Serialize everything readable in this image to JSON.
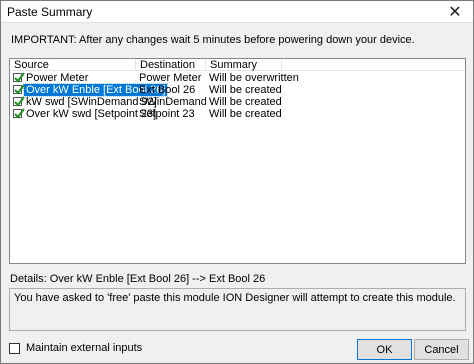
{
  "window": {
    "title": "Paste Summary",
    "close_glyph": "✕"
  },
  "important_text": "IMPORTANT: After any changes wait 5 minutes before powering down your device.",
  "table": {
    "columns": [
      "Source",
      "Destination",
      "Summary"
    ],
    "rows": [
      {
        "source": "Power Meter",
        "destination": "Power Meter",
        "summary": "Will be overwritten",
        "checked": true,
        "selected": false
      },
      {
        "source": "Over kW Enble [Ext Bool 26]",
        "destination": "Ext Bool 26",
        "summary": "Will be created",
        "checked": true,
        "selected": true
      },
      {
        "source": "kW swd [SWinDemand 92]",
        "destination": "SWinDemand 92",
        "summary": "Will be created",
        "checked": true,
        "selected": false
      },
      {
        "source": "Over kW swd [Setpoint 23]",
        "destination": "Setpoint 23",
        "summary": "Will be created",
        "checked": true,
        "selected": false
      }
    ]
  },
  "details_text": "Details: Over kW Enble [Ext Bool 26] --> Ext Bool 26",
  "message_text": "You have asked to 'free' paste this module  ION Designer will attempt to create this module.",
  "maintain_label": "Maintain external inputs",
  "buttons": {
    "ok": "OK",
    "cancel": "Cancel"
  },
  "colors": {
    "selection": "#0078d7",
    "check": "#1e8f1e"
  }
}
